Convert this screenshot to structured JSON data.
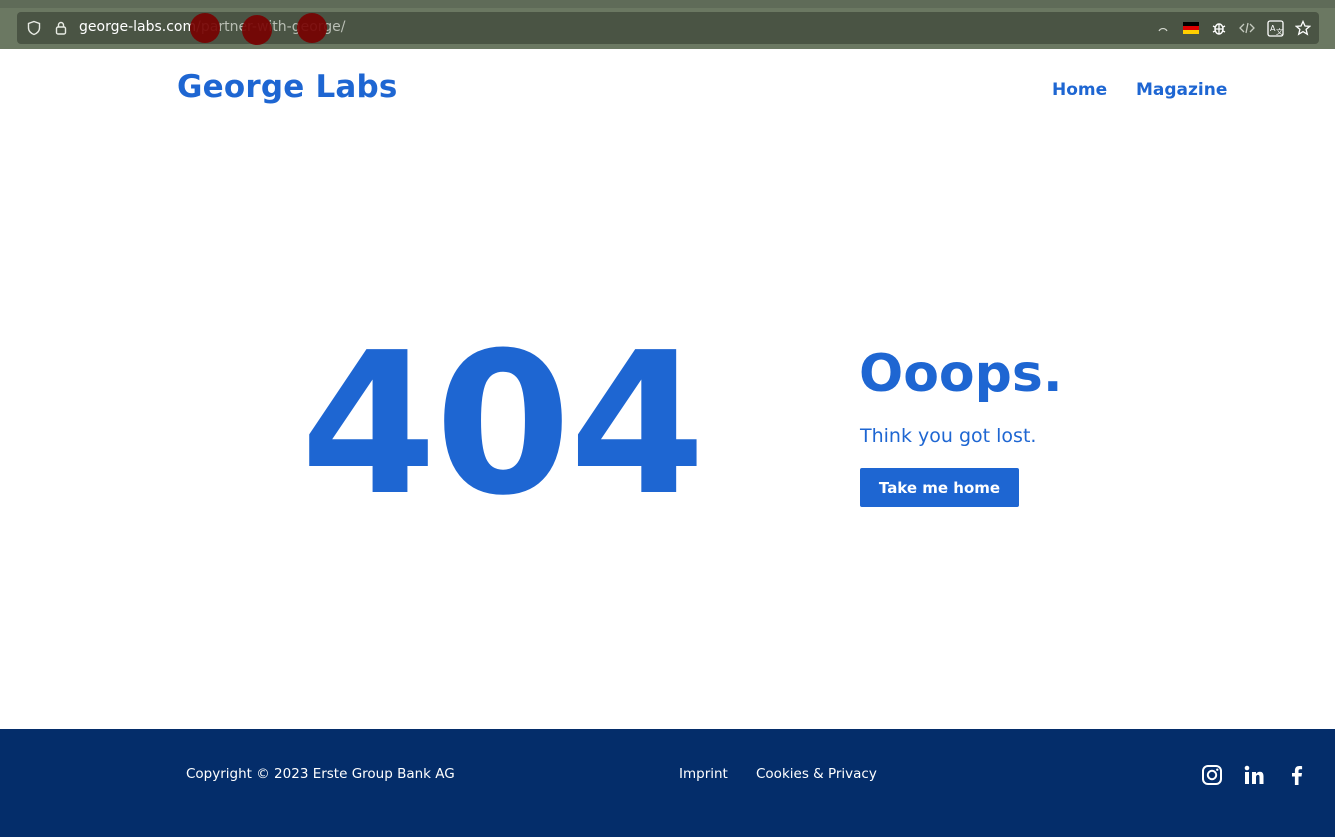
{
  "browser": {
    "url_host": "george-labs.com",
    "url_path": "/partner-with-george/"
  },
  "header": {
    "logo": "George Labs",
    "nav": [
      {
        "label": "Home"
      },
      {
        "label": "Magazine"
      }
    ]
  },
  "main": {
    "error_code": "404",
    "headline": "Ooops.",
    "subtext": "Think you got lost.",
    "button_label": "Take me home"
  },
  "footer": {
    "copyright": "Copyright © 2023 Erste Group Bank AG",
    "links": [
      {
        "label": "Imprint"
      },
      {
        "label": "Cookies & Privacy"
      }
    ],
    "social_icons": [
      "instagram-icon",
      "linkedin-icon",
      "facebook-icon"
    ]
  },
  "colors": {
    "brand_blue": "#1e66d2",
    "footer_navy": "#042d6a"
  }
}
